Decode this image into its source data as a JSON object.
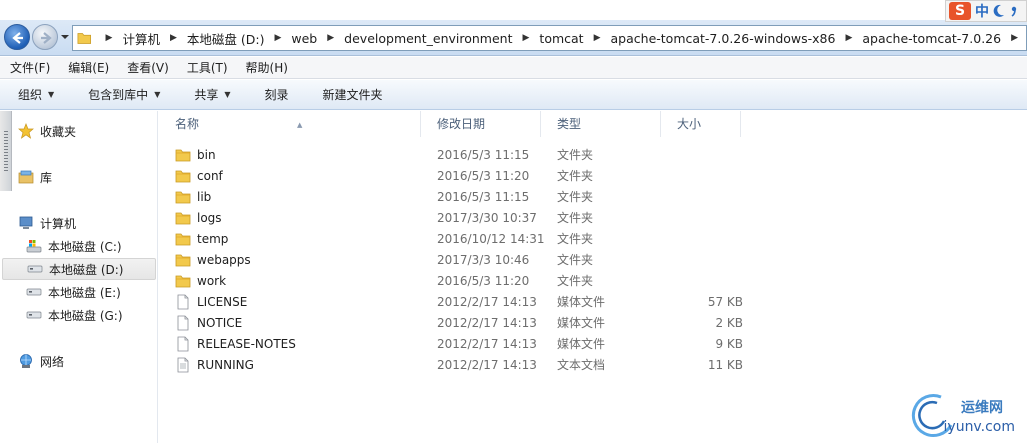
{
  "address": {
    "breadcrumbs": [
      "计算机",
      "本地磁盘 (D:)",
      "web",
      "development_environment",
      "tomcat",
      "apache-tomcat-7.0.26-windows-x86",
      "apache-tomcat-7.0.26"
    ]
  },
  "ime": {
    "logo": "S",
    "lang": "中"
  },
  "menu": [
    "文件(F)",
    "编辑(E)",
    "查看(V)",
    "工具(T)",
    "帮助(H)"
  ],
  "commands": [
    {
      "label": "组织",
      "dropdown": true
    },
    {
      "label": "包含到库中",
      "dropdown": true
    },
    {
      "label": "共享",
      "dropdown": true
    },
    {
      "label": "刻录",
      "dropdown": false
    },
    {
      "label": "新建文件夹",
      "dropdown": false
    }
  ],
  "nav": {
    "favorites": "收藏夹",
    "libraries": "库",
    "computer": "计算机",
    "drives": [
      "本地磁盘 (C:)",
      "本地磁盘 (D:)",
      "本地磁盘 (E:)",
      "本地磁盘 (G:)"
    ],
    "network": "网络"
  },
  "columns": {
    "name": "名称",
    "date": "修改日期",
    "type": "类型",
    "size": "大小"
  },
  "files": [
    {
      "name": "bin",
      "date": "2016/5/3 11:15",
      "type": "文件夹",
      "size": "",
      "kind": "folder"
    },
    {
      "name": "conf",
      "date": "2016/5/3 11:20",
      "type": "文件夹",
      "size": "",
      "kind": "folder"
    },
    {
      "name": "lib",
      "date": "2016/5/3 11:15",
      "type": "文件夹",
      "size": "",
      "kind": "folder"
    },
    {
      "name": "logs",
      "date": "2017/3/30 10:37",
      "type": "文件夹",
      "size": "",
      "kind": "folder"
    },
    {
      "name": "temp",
      "date": "2016/10/12 14:31",
      "type": "文件夹",
      "size": "",
      "kind": "folder"
    },
    {
      "name": "webapps",
      "date": "2017/3/3 10:46",
      "type": "文件夹",
      "size": "",
      "kind": "folder"
    },
    {
      "name": "work",
      "date": "2016/5/3 11:20",
      "type": "文件夹",
      "size": "",
      "kind": "folder"
    },
    {
      "name": "LICENSE",
      "date": "2012/2/17 14:13",
      "type": "媒体文件",
      "size": "57 KB",
      "kind": "file"
    },
    {
      "name": "NOTICE",
      "date": "2012/2/17 14:13",
      "type": "媒体文件",
      "size": "2 KB",
      "kind": "file"
    },
    {
      "name": "RELEASE-NOTES",
      "date": "2012/2/17 14:13",
      "type": "媒体文件",
      "size": "9 KB",
      "kind": "file"
    },
    {
      "name": "RUNNING",
      "date": "2012/2/17 14:13",
      "type": "文本文档",
      "size": "11 KB",
      "kind": "text"
    }
  ],
  "watermark": {
    "line1": "运维网",
    "line2": "iyunv.com"
  }
}
